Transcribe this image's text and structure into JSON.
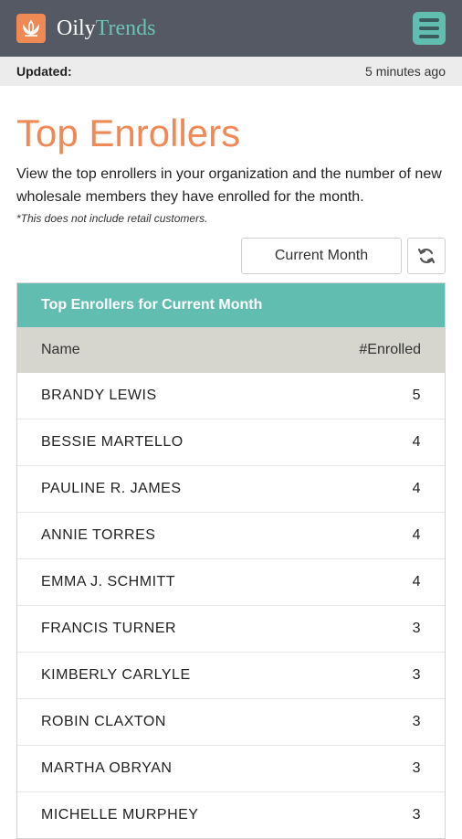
{
  "header": {
    "brand_part1": "Oily",
    "brand_part2": "Trends",
    "logo_icon": "lotus-icon",
    "menu_icon": "hamburger-icon",
    "colors": {
      "bar": "#555963",
      "accent": "#ef8a57",
      "teal": "#62bdb1"
    }
  },
  "status": {
    "label": "Updated:",
    "value": "5 minutes ago"
  },
  "page": {
    "title": "Top Enrollers",
    "description": "View the top enrollers in your organization and the number of new wholesale members they have enrolled for the month.",
    "note": "*This does not include retail customers."
  },
  "controls": {
    "period_selected": "Current Month",
    "refresh_icon": "refresh-icon"
  },
  "table": {
    "title": "Top Enrollers for Current Month",
    "columns": [
      "Name",
      "#Enrolled"
    ],
    "rows": [
      {
        "name": "BRANDY LEWIS",
        "count": "5"
      },
      {
        "name": "BESSIE MARTELLO",
        "count": "4"
      },
      {
        "name": "PAULINE R. JAMES",
        "count": "4"
      },
      {
        "name": "ANNIE TORRES",
        "count": "4"
      },
      {
        "name": "EMMA J. SCHMITT",
        "count": "4"
      },
      {
        "name": "FRANCIS TURNER",
        "count": "3"
      },
      {
        "name": "KIMBERLY CARLYLE",
        "count": "3"
      },
      {
        "name": "ROBIN CLAXTON",
        "count": "3"
      },
      {
        "name": "MARTHA OBRYAN",
        "count": "3"
      },
      {
        "name": "MICHELLE MURPHEY",
        "count": "3"
      }
    ]
  }
}
